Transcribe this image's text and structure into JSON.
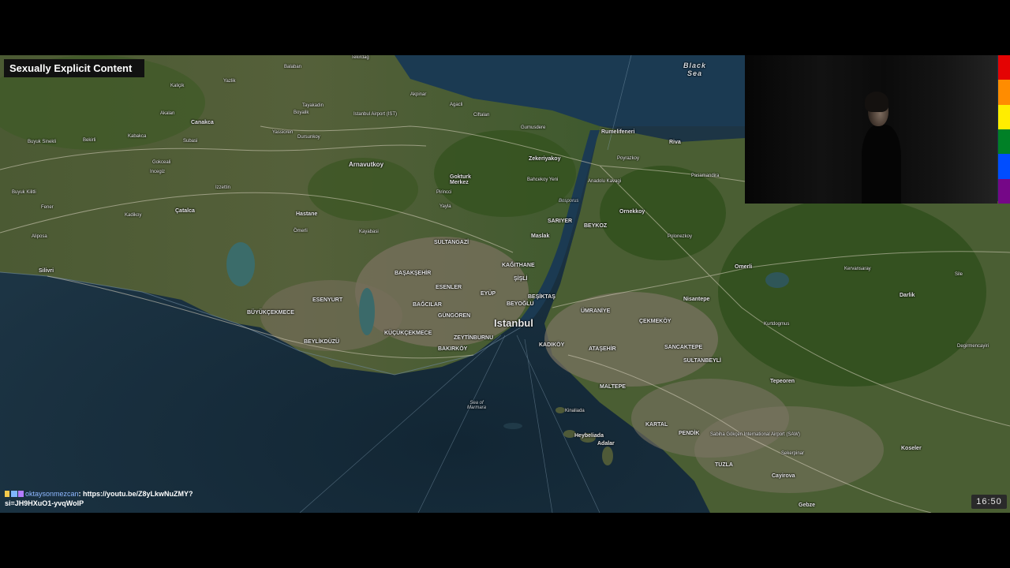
{
  "overlay": {
    "warning_label": "Sexually Explicit Content",
    "clock": "16:50",
    "chat": {
      "username": "oktaysonmezcan",
      "message_line1": "https://youtu.be/Z8yLkwNuZMY?",
      "message_line2": "si=JH9HXuO1-yvqWoIP"
    },
    "pride_colors": [
      "#e40303",
      "#ff8c00",
      "#ffed00",
      "#008026",
      "#004dff",
      "#750787"
    ]
  },
  "map": {
    "main_city": "Istanbul",
    "seas": [
      "Black Sea",
      "Sea of Marmara",
      "Bosporus"
    ],
    "place_labels": [
      "Tekirdag",
      "Balaban",
      "Yazlik",
      "Kaliçik",
      "Akalan",
      "Canakca",
      "Kabakca",
      "Subasi",
      "Buyuk Sinekli",
      "Bekirli",
      "Gokceali",
      "Incegiz",
      "Izzettin",
      "Buyuk Kilitli",
      "Fener",
      "Kadikoy",
      "Çatalca",
      "Aliposa",
      "Silivri",
      "Tayakadin",
      "Boyalik",
      "Yassioren",
      "Durusu",
      "Dursunkoy",
      "Arnavutkoy",
      "Ciftlik",
      "Istanbul Airport (IST)",
      "Agacli",
      "Ciftalan",
      "Gumusdere",
      "Rumelifeneri",
      "Riva",
      "Poyrazkoy",
      "Pasamandira",
      "Anadolu Kavagi",
      "Zekeriyakoy",
      "Bahcekoy Yeni",
      "Gokturk Merkez",
      "Pirincci",
      "Yayla",
      "Hastane",
      "Ömerli",
      "Kayabasi",
      "Sariyer",
      "Beykoz",
      "Ornekkoy",
      "Maslak",
      "SULTANGAZI",
      "KAĞITHANE",
      "ŞİŞLİ",
      "BEŞİKTAŞ",
      "BAŞAKŞEHİR",
      "ESENLER",
      "EYÜP",
      "BEYOĞLU",
      "BAĞCILAR",
      "GÜNGÖREN",
      "ZEYTİNBURNU",
      "BAKIRKÖY",
      "KÜÇÜKÇEKMECE",
      "ESENYURT",
      "BÜYÜKÇEKMECE",
      "BEYLİKDÜZÜ",
      "ÜMRANİYE",
      "KADIKÖY",
      "ATAŞEHİR",
      "ÇEKMEKÖY",
      "SANCAKTEPE",
      "SULTANBEYLİ",
      "MALTEPE",
      "KARTAL",
      "PENDİK",
      "TUZLA",
      "Nisantepe",
      "Polonezkoy",
      "Omerli",
      "Gebze",
      "Cayirova",
      "Sekerpinar",
      "Kinaliada",
      "Heybeliada",
      "Adalar",
      "Sabiha Gökçen International Airport (SAW)",
      "Tepeoren",
      "Kurtdogmus",
      "Darlik",
      "Koseler",
      "Kervansaray",
      "Degirmencayiri",
      "Sile"
    ]
  }
}
